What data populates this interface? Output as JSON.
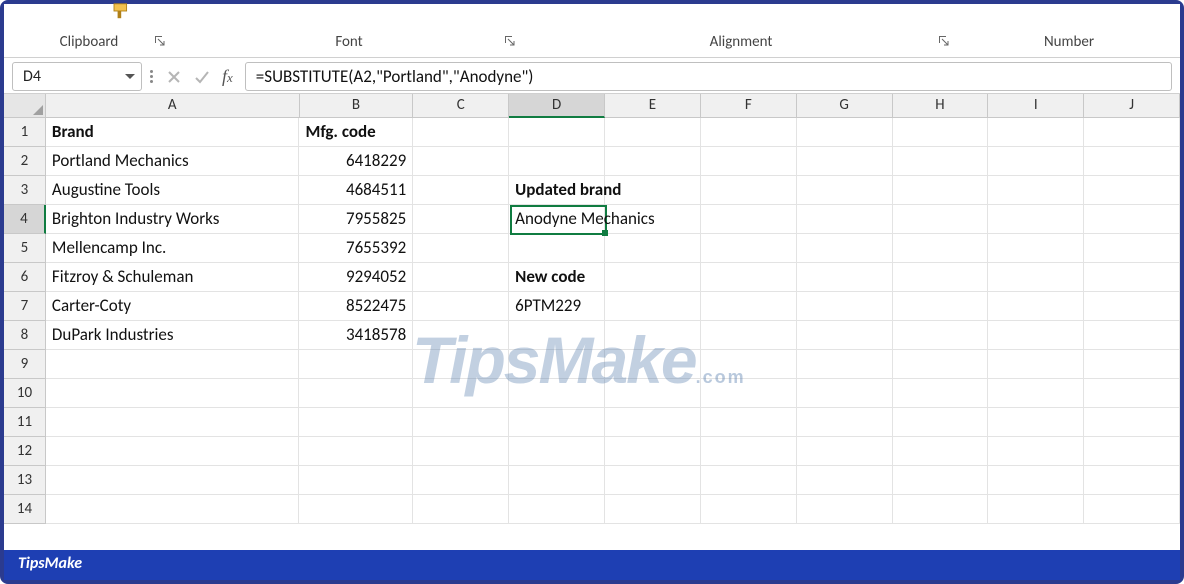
{
  "ribbon": {
    "clipboard_label": "Clipboard",
    "font_label": "Font",
    "alignment_label": "Alignment",
    "number_label": "Number"
  },
  "formula_bar": {
    "cell_ref": "D4",
    "formula": "=SUBSTITUTE(A2,\"Portland\",\"Anodyne\")"
  },
  "columns": [
    "A",
    "B",
    "C",
    "D",
    "E",
    "F",
    "G",
    "H",
    "I",
    "J"
  ],
  "row_numbers": [
    1,
    2,
    3,
    4,
    5,
    6,
    7,
    8,
    9,
    10,
    11,
    12,
    13,
    14
  ],
  "active": {
    "col": "D",
    "row": 4
  },
  "cells": {
    "A1": "Brand",
    "B1": "Mfg. code",
    "A2": "Portland Mechanics",
    "B2": "6418229",
    "A3": "Augustine Tools",
    "B3": "4684511",
    "D3": "Updated brand",
    "A4": "Brighton Industry Works",
    "B4": "7955825",
    "D4": "Anodyne Mechanics",
    "A5": "Mellencamp Inc.",
    "B5": "7655392",
    "A6": "Fitzroy & Schuleman",
    "B6": "9294052",
    "D6": "New code",
    "A7": "Carter-Coty",
    "B7": "8522475",
    "D7": "6PTM229",
    "A8": "DuPark Industries",
    "B8": "3418578"
  },
  "watermark": {
    "main": "TipsMake",
    "suffix": ".com"
  },
  "footer": "TipsMake"
}
